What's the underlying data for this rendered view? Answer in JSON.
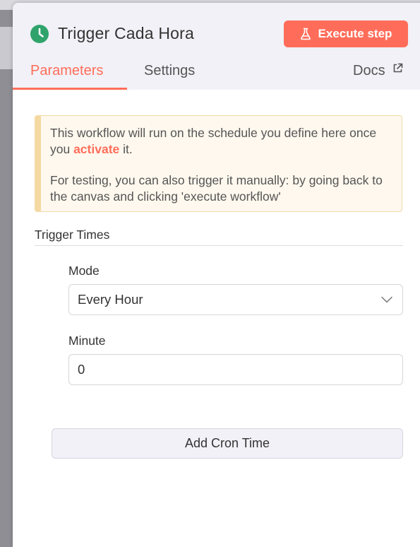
{
  "node": {
    "title": "Trigger Cada Hora",
    "icon": "clock-icon",
    "execute_label": "Execute step"
  },
  "tabs": [
    {
      "label": "Parameters",
      "active": true
    },
    {
      "label": "Settings",
      "active": false
    }
  ],
  "docs_label": "Docs",
  "notice": {
    "line1_before": "This workflow will run on the schedule you define here once you ",
    "line1_link": "activate",
    "line1_after": " it.",
    "line2": "For testing, you can also trigger it manually: by going back to the canvas and clicking 'execute workflow'"
  },
  "trigger_times": {
    "section_title": "Trigger Times",
    "mode_label": "Mode",
    "mode_value": "Every Hour",
    "minute_label": "Minute",
    "minute_value": "0",
    "add_button_label": "Add Cron Time"
  },
  "colors": {
    "accent": "#ff6d5a",
    "clock_icon": "#2fa36b",
    "notice_bg": "#fef8ee",
    "notice_border": "#f5d9a2"
  }
}
